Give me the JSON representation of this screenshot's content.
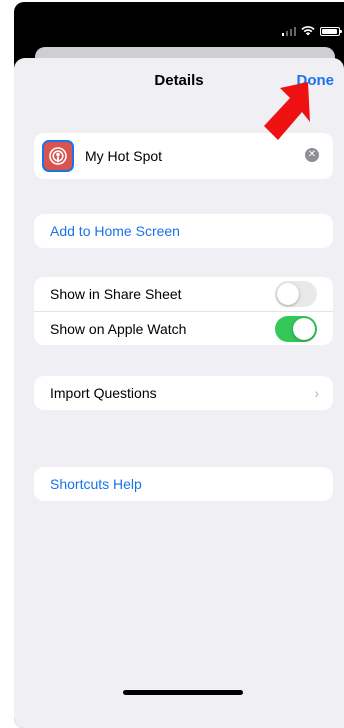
{
  "header": {
    "title": "Details",
    "done_label": "Done"
  },
  "shortcut": {
    "name": "My Hot Spot",
    "icon": "podcast-icon"
  },
  "actions": {
    "add_to_home": "Add to Home Screen",
    "import_questions": "Import Questions",
    "help": "Shortcuts Help"
  },
  "toggles": [
    {
      "label": "Show in Share Sheet",
      "on": false
    },
    {
      "label": "Show on Apple Watch",
      "on": true
    }
  ],
  "colors": {
    "accent": "#1a73e8",
    "toggle_on": "#34c759",
    "icon_bg": "#d9534f",
    "annotation_arrow": "#ee1111"
  }
}
